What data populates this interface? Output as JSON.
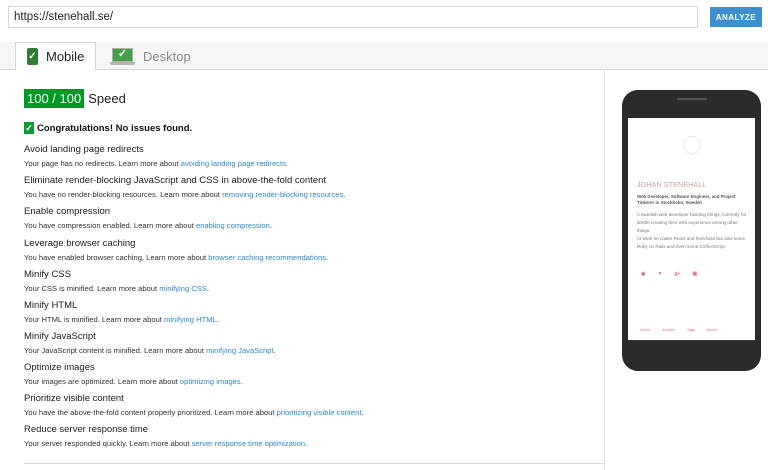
{
  "url": {
    "value": "https://stenehall.se/"
  },
  "analyze_label": "ANALYZE",
  "tabs": [
    {
      "label": "Mobile",
      "icon": "phone-check-icon",
      "active": true
    },
    {
      "label": "Desktop",
      "icon": "desktop-check-icon",
      "active": false
    }
  ],
  "score": {
    "value": "100 / 100",
    "label": "Speed",
    "color": "#009a27"
  },
  "congrats": "Congratulations! No issues found.",
  "rules": [
    {
      "title": "Avoid landing page redirects",
      "desc": "Your page has no redirects. Learn more about ",
      "link": "avoiding landing page redirects",
      "suffix": "."
    },
    {
      "title": "Eliminate render-blocking JavaScript and CSS in above-the-fold content",
      "desc": "You have no render-blocking resources. Learn more about ",
      "link": "removing render-blocking resources",
      "suffix": "."
    },
    {
      "title": "Enable compression",
      "desc": "You have compression enabled. Learn more about ",
      "link": "enabling compression",
      "suffix": "."
    },
    {
      "title": "Leverage browser caching",
      "desc": "You have enabled browser caching. Learn more about ",
      "link": "browser caching recommendations",
      "suffix": "."
    },
    {
      "title": "Minify CSS",
      "desc": "Your CSS is minified. Learn more about ",
      "link": "minifying CSS",
      "suffix": "."
    },
    {
      "title": "Minify HTML",
      "desc": "Your HTML is minified. Learn more about ",
      "link": "minifying HTML",
      "suffix": "."
    },
    {
      "title": "Minify JavaScript",
      "desc": "Your JavaScript content is minified. Learn more about ",
      "link": "minifying JavaScript",
      "suffix": "."
    },
    {
      "title": "Optimize images",
      "desc": "Your images are optimized. Learn more about ",
      "link": "optimizing images",
      "suffix": "."
    },
    {
      "title": "Prioritize visible content",
      "desc": "You have the above-the-fold content properly prioritized. Learn more about ",
      "link": "prioritizing visible content",
      "suffix": "."
    },
    {
      "title": "Reduce server response time",
      "desc": "Your server responded quickly. Learn more about ",
      "link": "server response time optimization",
      "suffix": "."
    }
  ],
  "preview": {
    "name": "JOHAN STENEHALL",
    "tagline": "Web Developer, Software Engineer, and Project Tinkerer in Stockholm, Sweden",
    "bio_1": "A swedish web developer building things, currently for iZettle creating their web experience among other things.",
    "bio_2": "At work he codes React and html/sass but also some Ruby on Rails and even some CoffeeScript.",
    "social_icons": [
      "github-icon",
      "twitter-icon",
      "google-plus-icon",
      "linkedin-icon"
    ],
    "footer_links": [
      "Home",
      "Archive",
      "Tags",
      "About"
    ]
  },
  "colors": {
    "accent": "#3e8ed0",
    "score_green": "#009a27",
    "link": "#2a8bd0",
    "preview_pink": "#e06a8c"
  }
}
